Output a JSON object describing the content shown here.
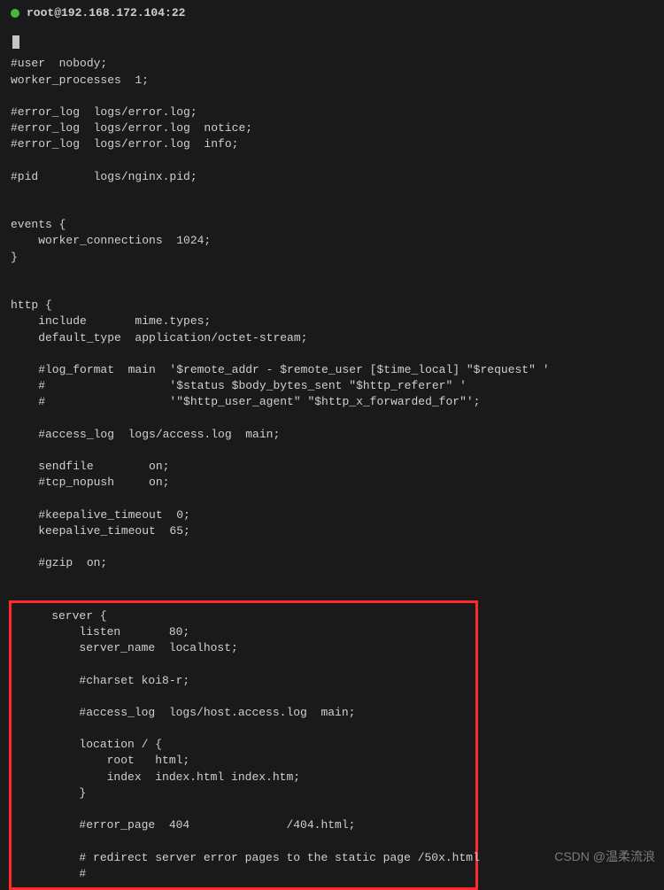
{
  "tab": {
    "title": "root@192.168.172.104:22",
    "status": "connected"
  },
  "cursor_row": 0,
  "main_lines": [
    "#user  nobody;",
    "worker_processes  1;",
    "",
    "#error_log  logs/error.log;",
    "#error_log  logs/error.log  notice;",
    "#error_log  logs/error.log  info;",
    "",
    "#pid        logs/nginx.pid;",
    "",
    "",
    "events {",
    "    worker_connections  1024;",
    "}",
    "",
    "",
    "http {",
    "    include       mime.types;",
    "    default_type  application/octet-stream;",
    "",
    "    #log_format  main  '$remote_addr - $remote_user [$time_local] \"$request\" '",
    "    #                  '$status $body_bytes_sent \"$http_referer\" '",
    "    #                  '\"$http_user_agent\" \"$http_x_forwarded_for\"';",
    "",
    "    #access_log  logs/access.log  main;",
    "",
    "    sendfile        on;",
    "    #tcp_nopush     on;",
    "",
    "    #keepalive_timeout  0;",
    "    keepalive_timeout  65;",
    "",
    "    #gzip  on;",
    "",
    ""
  ],
  "highlighted_lines": [
    "    server {",
    "        listen       80;",
    "        server_name  localhost;",
    "",
    "        #charset koi8-r;",
    "",
    "        #access_log  logs/host.access.log  main;",
    "",
    "        location / {",
    "            root   html;",
    "            index  index.html index.htm;",
    "        }",
    "",
    "        #error_page  404              /404.html;",
    "",
    "        # redirect server error pages to the static page /50x.html",
    "        #"
  ],
  "watermark": "CSDN @温柔流浪"
}
